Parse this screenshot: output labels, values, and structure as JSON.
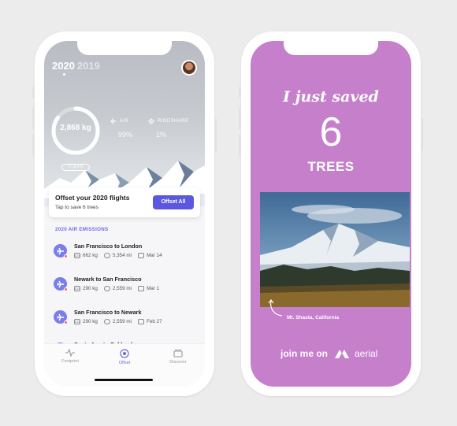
{
  "left_phone": {
    "years": {
      "active": "2020",
      "inactive": "2019"
    },
    "ring": {
      "value": "2,868 kg",
      "progress": 0.85
    },
    "stats": [
      {
        "label": "AIR",
        "value": "99%",
        "icon": "plane-icon"
      },
      {
        "label": "RIDESHARE",
        "value": "1%",
        "icon": "rideshare-icon"
      }
    ],
    "clean_label": "CLEAN",
    "offset_card": {
      "title": "Offset your 2020 flights",
      "subtitle": "Tap to save 6 trees",
      "button": "Offset All"
    },
    "section_title": "2020 AIR EMISSIONS",
    "flights": [
      {
        "route": "San Francisco to London",
        "co2": "662 kg",
        "distance": "5,354 mi",
        "date": "Mar 14"
      },
      {
        "route": "Newark to San Francisco",
        "co2": "290 kg",
        "distance": "2,559 mi",
        "date": "Mar 1"
      },
      {
        "route": "San Francisco to Newark",
        "co2": "290 kg",
        "distance": "2,559 mi",
        "date": "Feb 27"
      },
      {
        "route": "Santa Ana to Oakland",
        "co2": "",
        "distance": "",
        "date": ""
      }
    ],
    "tabs": [
      {
        "label": "Footprint",
        "icon": "pulse-icon",
        "active": false
      },
      {
        "label": "Offset",
        "icon": "offset-icon",
        "active": true
      },
      {
        "label": "Discover",
        "icon": "cards-icon",
        "active": false
      }
    ]
  },
  "right_phone": {
    "headline": "I just saved",
    "count": "6",
    "unit": "TREES",
    "photo_caption": "Mt. Shasta, California",
    "join_text": "join me on",
    "brand": "aerial",
    "background_color": "#c57fcb"
  }
}
